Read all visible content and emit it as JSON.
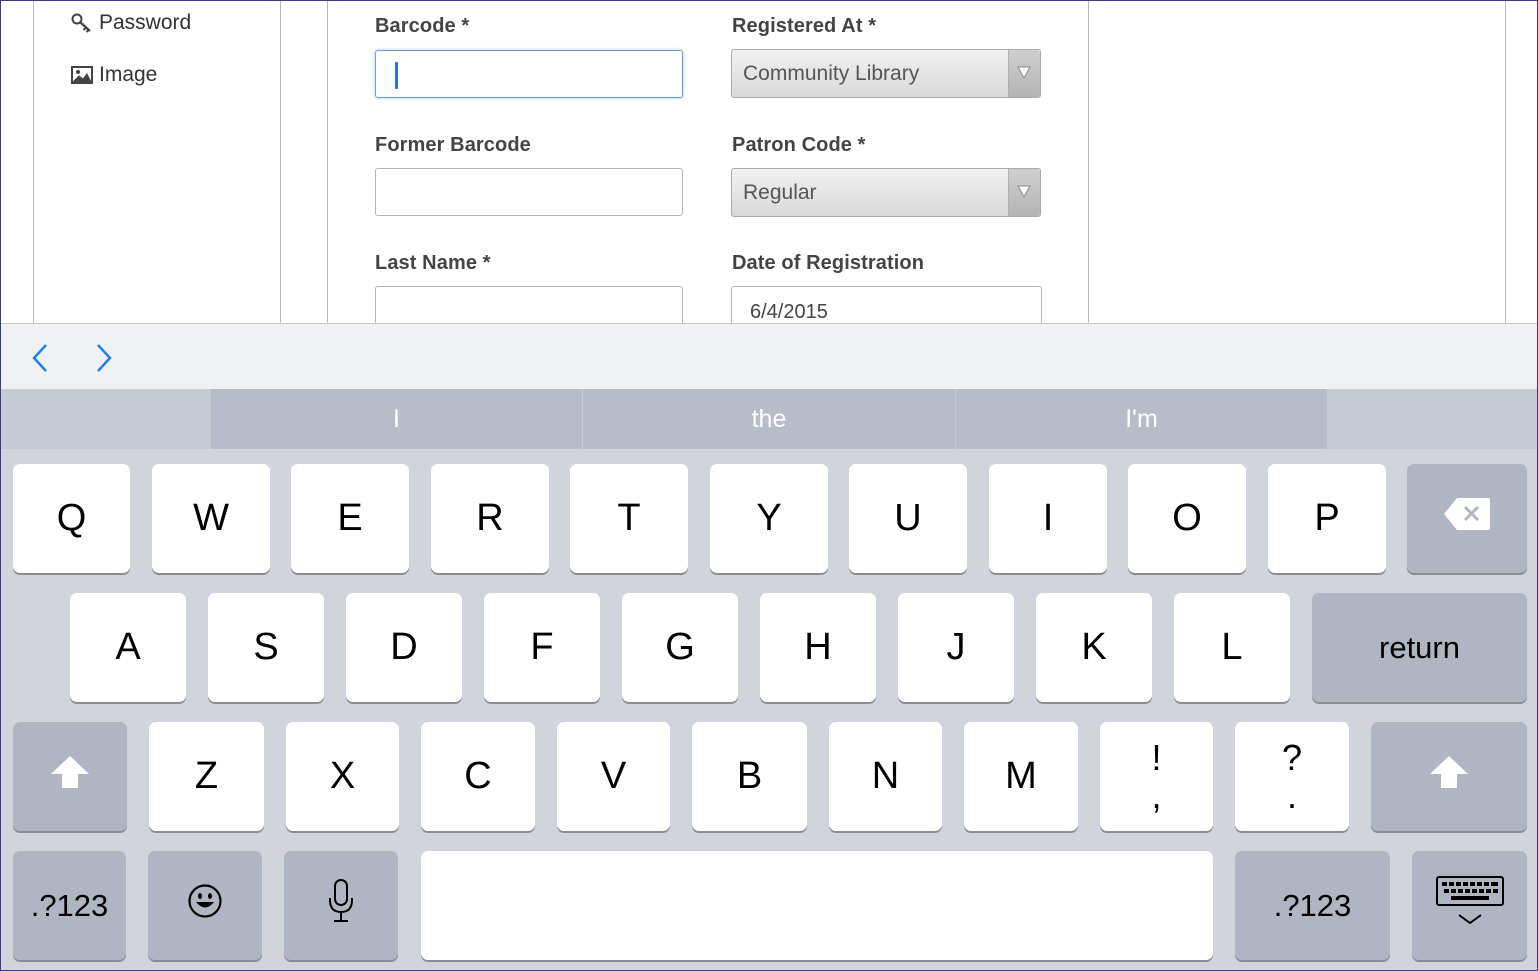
{
  "sidebar": {
    "items": [
      {
        "label": "Password",
        "icon": "key-icon"
      },
      {
        "label": "Image",
        "icon": "image-icon"
      }
    ]
  },
  "form": {
    "barcode": {
      "label": "Barcode *",
      "value": ""
    },
    "registered_at": {
      "label": "Registered At *",
      "value": "Community Library"
    },
    "former_barcode": {
      "label": "Former Barcode",
      "value": ""
    },
    "patron_code": {
      "label": "Patron Code *",
      "value": "Regular"
    },
    "last_name": {
      "label": "Last Name *",
      "value": ""
    },
    "date_of_registration": {
      "label": "Date of Registration",
      "value": "6/4/2015"
    }
  },
  "accessory": {
    "prev_icon": "chevron-left-icon",
    "next_icon": "chevron-right-icon",
    "color": "#1a7cf0"
  },
  "keyboard": {
    "predictions": [
      "I",
      "the",
      "I'm"
    ],
    "row1": [
      "Q",
      "W",
      "E",
      "R",
      "T",
      "Y",
      "U",
      "I",
      "O",
      "P"
    ],
    "row2": [
      "A",
      "S",
      "D",
      "F",
      "G",
      "H",
      "J",
      "K",
      "L"
    ],
    "row3": [
      "Z",
      "X",
      "C",
      "V",
      "B",
      "N",
      "M"
    ],
    "punct1": {
      "top": "!",
      "bottom": ","
    },
    "punct2": {
      "top": "?",
      "bottom": "."
    },
    "return_label": "return",
    "numbers_label": ".?123",
    "icons": [
      "delete-icon",
      "shift-icon",
      "emoji-icon",
      "microphone-icon",
      "dismiss-keyboard-icon"
    ]
  }
}
